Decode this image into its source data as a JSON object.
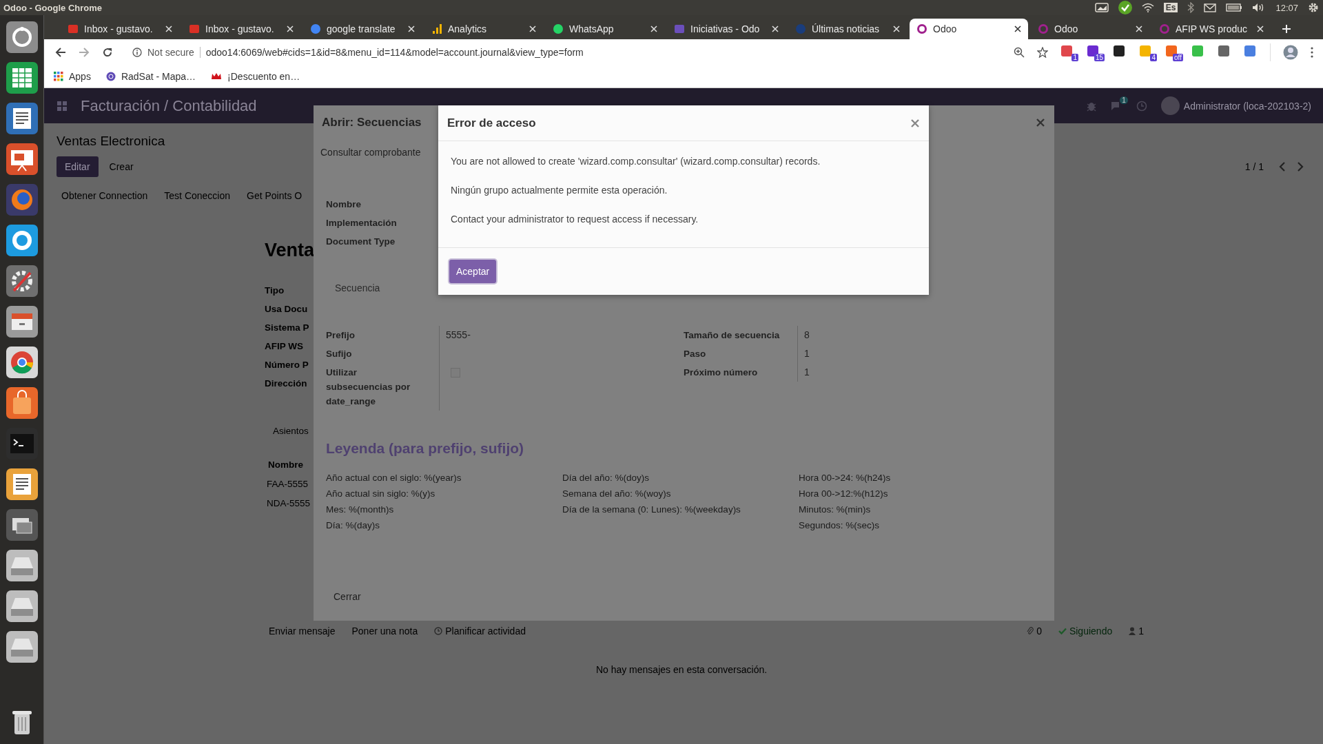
{
  "system_bar": {
    "window_title": "Odoo - Google Chrome",
    "keyboard_layout": "Es",
    "time": "12:07"
  },
  "browser": {
    "tabs": [
      {
        "title": "Inbox - gustavo.",
        "selected": false
      },
      {
        "title": "Inbox - gustavo.",
        "selected": false
      },
      {
        "title": "google translate",
        "selected": false
      },
      {
        "title": "Analytics",
        "selected": false
      },
      {
        "title": "WhatsApp",
        "selected": false
      },
      {
        "title": "Iniciativas - Odo",
        "selected": false
      },
      {
        "title": "Últimas noticias",
        "selected": false
      },
      {
        "title": "Odoo",
        "selected": true
      },
      {
        "title": "Odoo",
        "selected": false
      },
      {
        "title": "AFIP WS produc",
        "selected": false
      }
    ],
    "security_label": "Not secure",
    "url": "odoo14:6069/web#cids=1&id=8&menu_id=114&model=account.journal&view_type=form",
    "extension_badges": [
      "1",
      "15",
      "4",
      "off"
    ],
    "bookmarks": [
      "Apps",
      "RadSat - Mapa…",
      "¡Descuento en…"
    ]
  },
  "odoo": {
    "app_title": "Facturación / Contabilidad",
    "chat_badge": "1",
    "user": "Administrator (loca-202103-2)",
    "breadcrumb": "Ventas Electronica",
    "buttons": [
      "Editar",
      "Crear"
    ],
    "pager": "1 / 1",
    "header_buttons": [
      "Obtener Connection",
      "Test Coneccion",
      "Get Points O"
    ],
    "record_title": "Venta",
    "fields": [
      "Tipo",
      "Usa Docu",
      "Sistema P",
      "AFIP WS",
      "Número P",
      "Dirección"
    ],
    "notebook_tab": "Asientos",
    "table_header": "Nombre",
    "table_rows": [
      "FAA-5555",
      "NDA-5555"
    ],
    "chatter": {
      "actions": [
        "Enviar mensaje",
        "Poner una nota",
        "Planificar actividad"
      ],
      "attachments": "0",
      "follow": "Siguiendo",
      "followers": "1",
      "empty": "No hay mensajes en esta conversación."
    }
  },
  "sequence_dialog": {
    "title": "Abrir: Secuencias",
    "header_button": "Consultar comprobante",
    "fields": [
      "Nombre",
      "Implementación",
      "Document Type"
    ],
    "tab": "Secuencia",
    "left_group": [
      {
        "label": "Prefijo",
        "kind": "text",
        "value": "5555-"
      },
      {
        "label": "Sufijo",
        "kind": "text"
      },
      {
        "label": "Utilizar subsecuencias por date_range",
        "kind": "checkbox",
        "checked": false
      }
    ],
    "right_group": [
      {
        "label": "Tamaño de secuencia",
        "value": "8"
      },
      {
        "label": "Paso",
        "value": "1"
      },
      {
        "label": "Próximo número",
        "value": "1"
      }
    ],
    "legend_title": "Leyenda (para prefijo, sufijo)",
    "legend_columns": [
      [
        "Año actual con el siglo: %(year)s",
        "Año actual sin siglo: %(y)s",
        "Mes: %(month)s",
        "Día: %(day)s"
      ],
      [
        "Día del año: %(doy)s",
        "Semana del año: %(woy)s",
        "Día de la semana (0: Lunes): %(weekday)s"
      ],
      [
        "Hora 00->24: %(h24)s",
        "Hora 00->12:%(h12)s",
        "Minutos: %(min)s",
        "Segundos: %(sec)s"
      ]
    ],
    "footer_button": "Cerrar"
  },
  "error_dialog": {
    "title": "Error de acceso",
    "messages": [
      "You are not allowed to create 'wizard.comp.consultar' (wizard.comp.consultar) records.",
      "Ningún grupo actualmente permite esta operación.",
      "Contact your administrator to request access if necessary."
    ],
    "button": "Aceptar"
  }
}
